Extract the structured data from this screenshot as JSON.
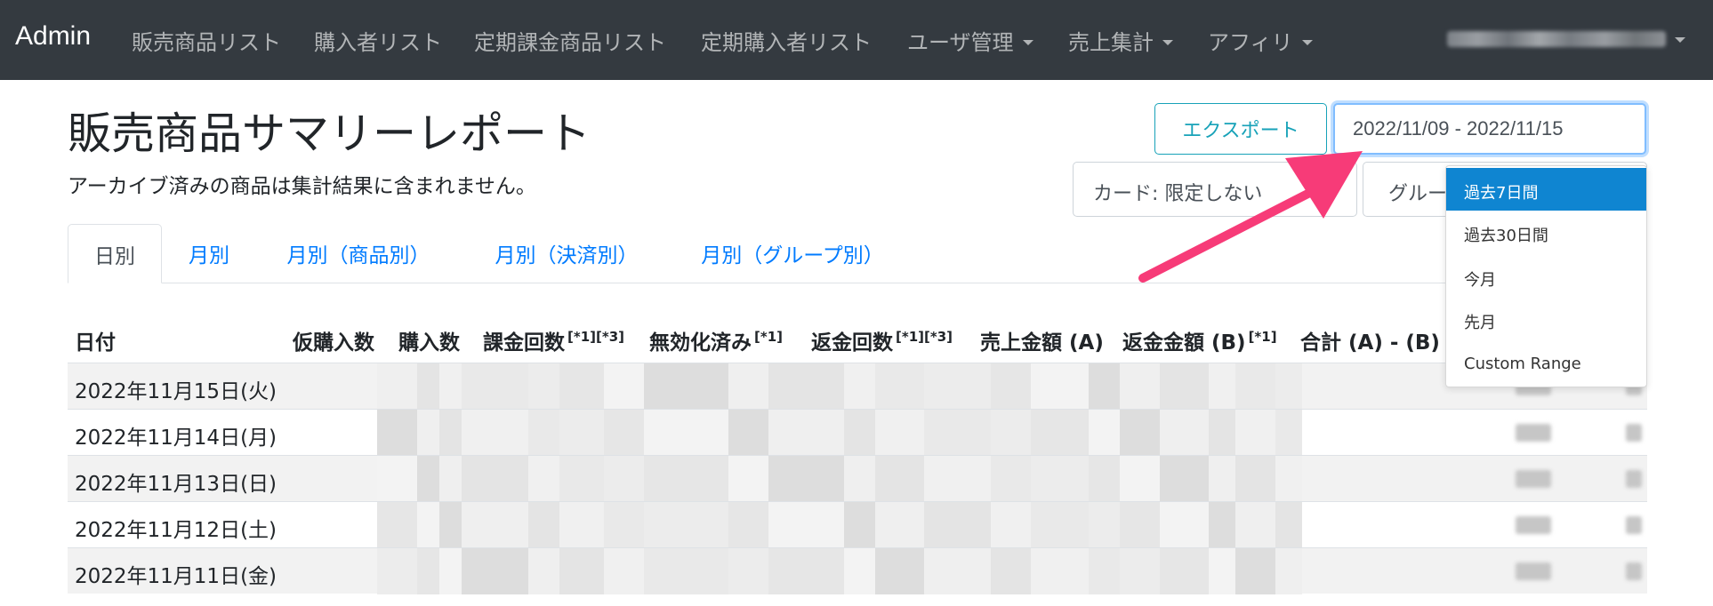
{
  "navbar": {
    "brand": "Admin",
    "items": [
      {
        "label": "販売商品リスト",
        "dropdown": false
      },
      {
        "label": "購入者リスト",
        "dropdown": false
      },
      {
        "label": "定期課金商品リスト",
        "dropdown": false
      },
      {
        "label": "定期購入者リスト",
        "dropdown": false
      },
      {
        "label": "ユーザ管理",
        "dropdown": true
      },
      {
        "label": "売上集計",
        "dropdown": true
      },
      {
        "label": "アフィリ",
        "dropdown": true
      }
    ],
    "user_menu": {
      "dropdown": true,
      "redacted": true
    }
  },
  "header": {
    "title": "販売商品サマリーレポート",
    "subtitle": "アーカイブ済みの商品は集計結果に含まれません。",
    "export_label": "エクスポート",
    "date_range": "2022/11/09 - 2022/11/15",
    "card_filter": "カード: 限定しない",
    "group_filter": "グループ: 限定しない"
  },
  "tabs": [
    {
      "label": "日別",
      "active": true
    },
    {
      "label": "月別",
      "active": false
    },
    {
      "label": "月別（商品別）",
      "active": false
    },
    {
      "label": "月別（決済別）",
      "active": false
    },
    {
      "label": "月別（グループ別）",
      "active": false
    }
  ],
  "table": {
    "headers": [
      {
        "label": "日付",
        "sup": ""
      },
      {
        "label": "仮購入数",
        "sup": ""
      },
      {
        "label": "購入数",
        "sup": ""
      },
      {
        "label": "課金回数",
        "sup": "[*1][*3]"
      },
      {
        "label": "無効化済み",
        "sup": "[*1]"
      },
      {
        "label": "返金回数",
        "sup": "[*1][*3]"
      },
      {
        "label": "売上金額 (A)",
        "sup": ""
      },
      {
        "label": "返金金額 (B)",
        "sup": "[*1]"
      },
      {
        "label": "合計 (A) - (B)",
        "sup": ""
      }
    ],
    "rows": [
      {
        "date": "2022年11月15日(火)"
      },
      {
        "date": "2022年11月14日(月)"
      },
      {
        "date": "2022年11月13日(日)"
      },
      {
        "date": "2022年11月12日(土)"
      },
      {
        "date": "2022年11月11日(金)"
      }
    ]
  },
  "date_picker": {
    "ranges": [
      {
        "label": "過去7日間",
        "active": true
      },
      {
        "label": "過去30日間",
        "active": false
      },
      {
        "label": "今月",
        "active": false
      },
      {
        "label": "先月",
        "active": false
      },
      {
        "label": "Custom Range",
        "active": false
      }
    ]
  },
  "colors": {
    "navbar_bg": "#343a40",
    "link": "#007bff",
    "export_accent": "#17a2b8",
    "dropdown_active": "#0f85d1",
    "annotation_arrow": "#f73b78"
  }
}
